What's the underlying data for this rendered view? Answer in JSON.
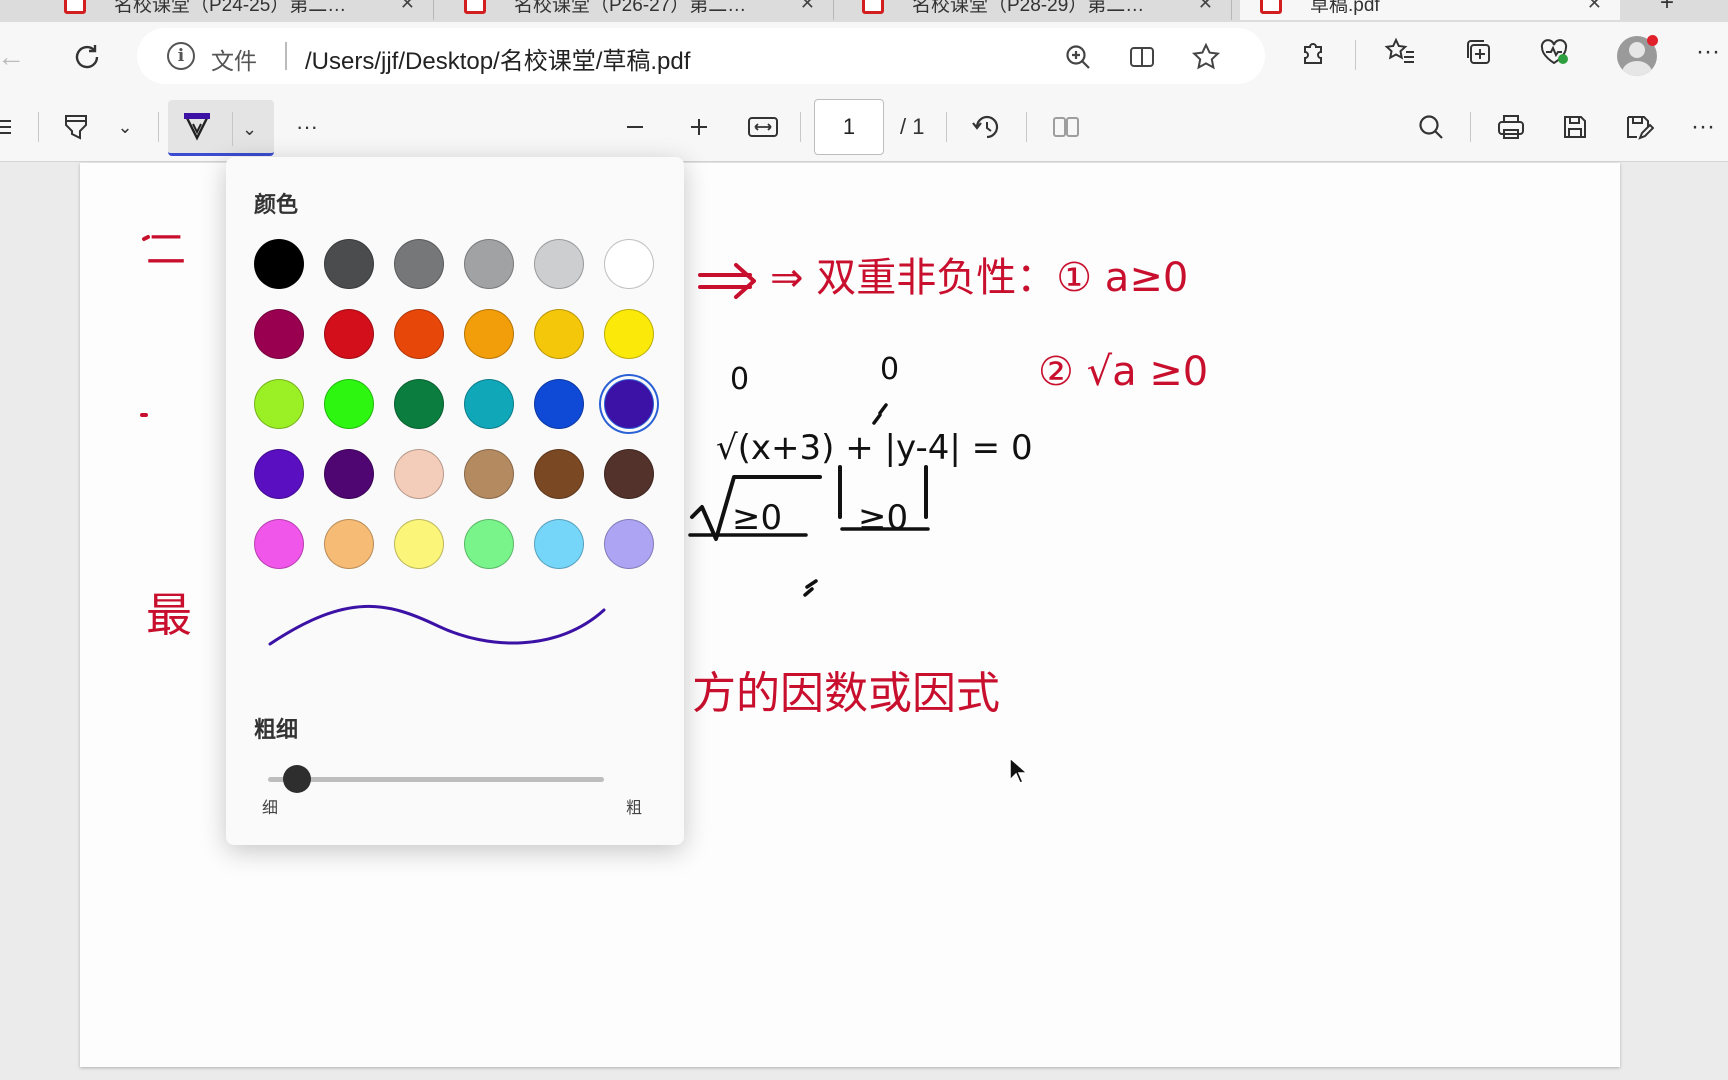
{
  "tabs": [
    {
      "title": "名校课堂（P24-25）第二…"
    },
    {
      "title": "名校课堂（P26-27）第二…"
    },
    {
      "title": "名校课堂（P28-29）第二…"
    },
    {
      "title": "草稿.pdf"
    }
  ],
  "address_bar": {
    "scheme_label": "文件",
    "url": "/Users/jjf/Desktop/名校课堂/草稿.pdf"
  },
  "pdf_toolbar": {
    "current_page": "1",
    "total_pages": "/ 1",
    "more_label": "···"
  },
  "pen_flyout": {
    "color_title": "颜色",
    "colors": [
      "#000000",
      "#4a4c4e",
      "#767779",
      "#a1a2a4",
      "#cdcecf",
      "#ffffff",
      "#9a0050",
      "#d20f1b",
      "#e8470a",
      "#f29d0a",
      "#f5c70a",
      "#fbe90a",
      "#9bef25",
      "#2df711",
      "#0b7e3f",
      "#10a7b9",
      "#0f4ad7",
      "#3b11a6",
      "#5a0fc0",
      "#4f0673",
      "#f3cdb9",
      "#b48a61",
      "#7b4824",
      "#52322a",
      "#f056ea",
      "#f6bb75",
      "#fbf57a",
      "#78f48a",
      "#75d6fa",
      "#ada5f4"
    ],
    "selected_color": "#3b11a6",
    "thickness_title": "粗细",
    "thickness_min": "细",
    "thickness_max": "粗",
    "thickness_value": 0.05
  },
  "page_notes": {
    "line_properties": "⇒ 双重非负性：① a≥0",
    "line_properties_2": "② √a ≥0",
    "equation": "√(x+3) + |y-4| = 0",
    "zero_a": "0",
    "zero_b": "0",
    "ge0_a": "≥0",
    "ge0_b": "≥0",
    "factors": "方的因数或因式",
    "left_heading_1": "二",
    "left_heading_2": "最"
  }
}
